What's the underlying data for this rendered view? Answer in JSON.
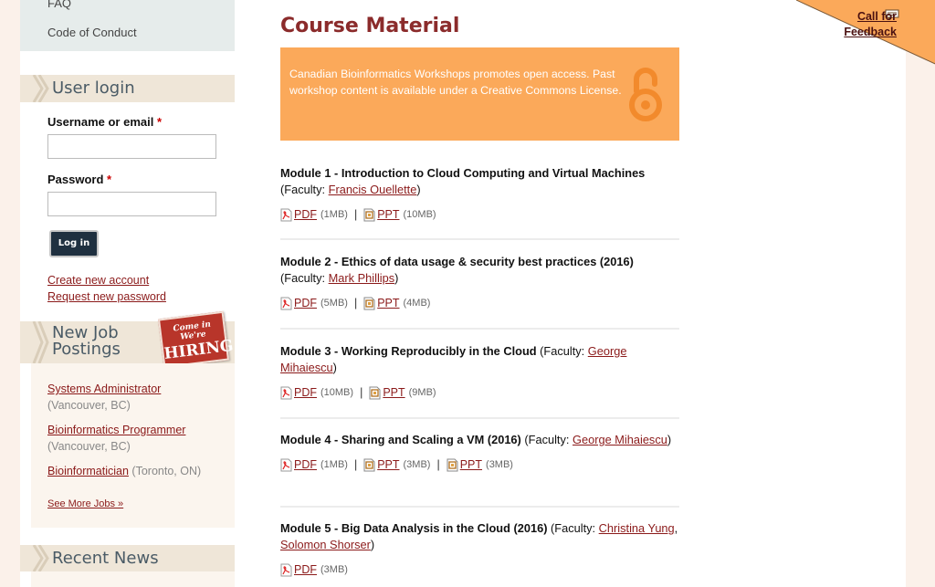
{
  "menu": {
    "faq": "FAQ",
    "code_of_conduct": "Code of Conduct"
  },
  "login": {
    "title": "User login",
    "username_label": "Username or email",
    "password_label": "Password",
    "required": "*",
    "button": "Log in",
    "create_account": "Create new account",
    "request_password": "Request new password"
  },
  "jobs": {
    "title_line1": "New Job",
    "title_line2": "Postings",
    "badge_line1": "Come in We're",
    "badge_line2": "HIRING",
    "items": [
      {
        "title": "Systems Administrator",
        "location": "(Vancouver, BC)"
      },
      {
        "title": "Bioinformatics Programmer",
        "location": "(Vancouver, BC)"
      },
      {
        "title": "Bioinformatician",
        "location": "(Toronto, ON)"
      }
    ],
    "see_more": "See More Jobs »"
  },
  "news": {
    "title": "Recent News"
  },
  "main": {
    "title": "Course Material",
    "notice": "Canadian Bioinformatics Workshops promotes open access. Past workshop content is available under a Creative Commons License.",
    "faculty_prefix": "(Faculty: ",
    "faculty_suffix": ")",
    "separator": "|",
    "modules": [
      {
        "title": "Module 1 - Introduction to Cloud Computing and Virtual Machines",
        "faculty": [
          "Francis Ouellette"
        ],
        "files": [
          {
            "type": "PDF",
            "size": "(1MB)"
          },
          {
            "type": "PPT",
            "size": "(10MB)"
          }
        ]
      },
      {
        "title": "Module 2 - Ethics of data usage & security best practices (2016)",
        "faculty": [
          "Mark Phillips"
        ],
        "files": [
          {
            "type": "PDF",
            "size": "(5MB)"
          },
          {
            "type": "PPT",
            "size": "(4MB)"
          }
        ]
      },
      {
        "title": "Module 3 - Working Reproducibly in the Cloud",
        "faculty": [
          "George Mihaiescu"
        ],
        "files": [
          {
            "type": "PDF",
            "size": "(10MB)"
          },
          {
            "type": "PPT",
            "size": "(9MB)"
          }
        ]
      },
      {
        "title": "Module 4 - Sharing and Scaling a VM (2016)",
        "faculty": [
          "George Mihaiescu"
        ],
        "files": [
          {
            "type": "PDF",
            "size": "(1MB)"
          },
          {
            "type": "PPT",
            "size": "(3MB)"
          },
          {
            "type": "PPT",
            "size": "(3MB)"
          }
        ]
      },
      {
        "title": "Module 5 - Big Data Analysis in the Cloud (2016)",
        "faculty": [
          "Christina Yung",
          "Solomon Shorser"
        ],
        "files": [
          {
            "type": "PDF",
            "size": "(3MB)"
          }
        ]
      }
    ]
  },
  "feedback": {
    "line1": "Call for",
    "line2": "Feedback"
  },
  "colors": {
    "accent": "#8b1a1a",
    "notice_bg": "#fba95a",
    "ribbon_bg": "#fba95a",
    "sidebar_title_bg": "#efe6d8"
  }
}
